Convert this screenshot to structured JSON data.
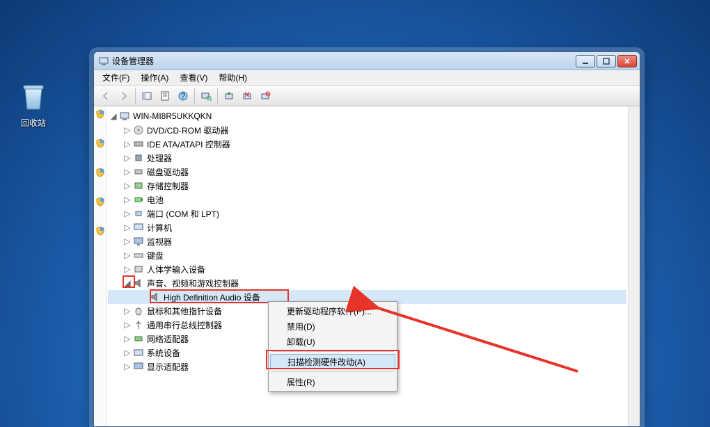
{
  "desktop": {
    "recycle_bin": "回收站"
  },
  "window": {
    "title": "设备管理器"
  },
  "menubar": {
    "file": "文件(F)",
    "action": "操作(A)",
    "view": "查看(V)",
    "help": "帮助(H)"
  },
  "tree": {
    "root": "WIN-MI8R5UKKQKN",
    "items": {
      "dvd": "DVD/CD-ROM 驱动器",
      "ide": "IDE ATA/ATAPI 控制器",
      "cpu": "处理器",
      "disk": "磁盘驱动器",
      "storage": "存储控制器",
      "battery": "电池",
      "ports": "端口 (COM 和 LPT)",
      "computer": "计算机",
      "monitor": "监视器",
      "keyboard": "键盘",
      "hid": "人体学输入设备",
      "sound": "声音、视频和游戏控制器",
      "sound_child": "High Definition Audio 设备",
      "mouse": "鼠标和其他指针设备",
      "usb": "通用串行总线控制器",
      "network": "网络适配器",
      "system": "系统设备",
      "display": "显示适配器"
    }
  },
  "context_menu": {
    "update": "更新驱动程序软件(P)...",
    "disable": "禁用(D)",
    "uninstall": "卸载(U)",
    "scan": "扫描检测硬件改动(A)",
    "properties": "属性(R)"
  },
  "colors": {
    "annotation": "#e6342a"
  }
}
